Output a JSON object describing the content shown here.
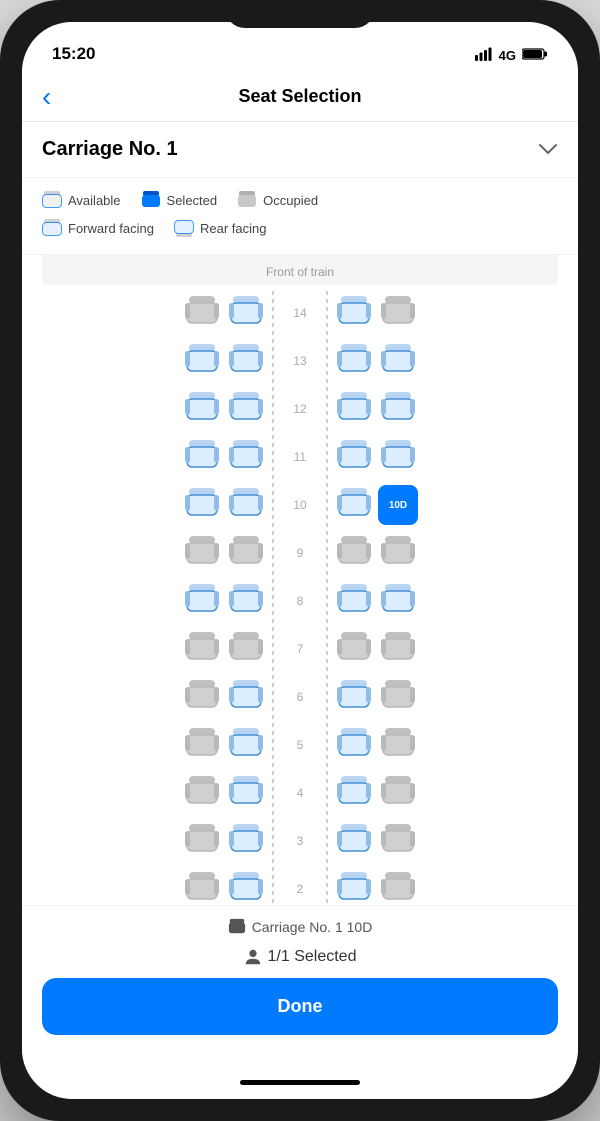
{
  "statusBar": {
    "time": "15:20",
    "signal": "●●●●",
    "network": "4G",
    "battery": "🔋"
  },
  "nav": {
    "back": "‹",
    "title": "Seat Selection"
  },
  "carriageHeader": {
    "title": "Carriage No. 1",
    "chevron": "⌄"
  },
  "legend": {
    "available": "Available",
    "selected": "Selected",
    "occupied": "Occupied",
    "forwardFacing": "Forward facing",
    "rearFacing": "Rear facing"
  },
  "seatMap": {
    "frontLabel": "Front of train",
    "selectedSeat": "10D",
    "rows": [
      14,
      13,
      12,
      11,
      10,
      9,
      8,
      7,
      6,
      5,
      4,
      3,
      2
    ]
  },
  "bottomInfo": {
    "carriageSeatIcon": "🪑",
    "carriageSeat": "Carriage No. 1 10D",
    "personIcon": "👤",
    "selectedCount": "1/1 Selected",
    "doneLabel": "Done"
  }
}
